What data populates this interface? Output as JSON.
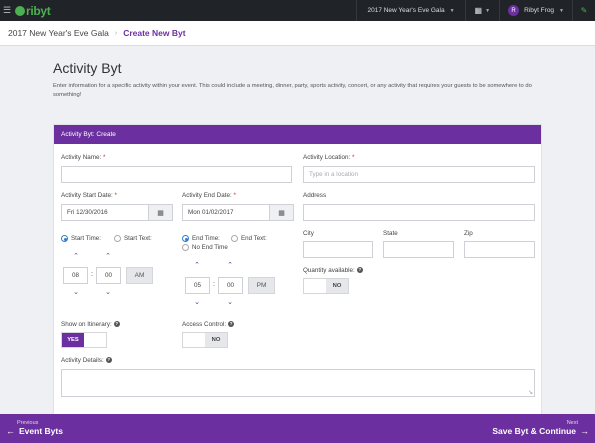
{
  "topbar": {
    "logo_text": "ribyt",
    "event_name": "2017 New Year's Eve Gala",
    "user_initial": "R",
    "user_name": "Ribyt Frog",
    "brand_color": "#6b2fa0",
    "accent_color": "#4caf50"
  },
  "breadcrumb": {
    "parent": "2017 New Year's Eve Gala",
    "current": "Create New Byt"
  },
  "page": {
    "title": "Activity Byt",
    "intro": "Enter information for a specific activity within your event. This could include a meeting, dinner, party, sports activity, concert, or any activity that requires your guests to be somewhere to do something!"
  },
  "panel": {
    "header": "Activity Byt: Create"
  },
  "form": {
    "activity_name_label": "Activity Name:",
    "activity_name_value": "",
    "activity_location_label": "Activity Location:",
    "activity_location_placeholder": "Type in a location",
    "start_date_label": "Activity Start Date:",
    "start_date_value": "Fri 12/30/2016",
    "end_date_label": "Activity End Date:",
    "end_date_value": "Mon 01/02/2017",
    "address_label": "Address",
    "start_time_option": "Start Time:",
    "start_text_option": "Start Text:",
    "end_time_option": "End Time:",
    "end_text_option": "End Text:",
    "no_end_time_option": "No End Time",
    "start_hour": "08",
    "start_minute": "00",
    "start_ampm": "AM",
    "end_hour": "05",
    "end_minute": "00",
    "end_ampm": "PM",
    "city_label": "City",
    "state_label": "State",
    "zip_label": "Zip",
    "quantity_label": "Quantity available:",
    "quantity_toggle": "NO",
    "itinerary_label": "Show on Itinerary:",
    "itinerary_toggle": "YES",
    "access_label": "Access Control:",
    "access_toggle": "NO",
    "details_label": "Activity Details:",
    "required_mark": "*",
    "help_mark": "?"
  },
  "nav": {
    "prev_small": "Previous",
    "prev_label": "Event Byts",
    "next_small": "Next",
    "next_label": "Save Byt & Continue"
  },
  "icons": [
    "menu-icon",
    "logo-icon",
    "grid-icon",
    "chevron-down-icon",
    "link-icon",
    "calendar-icon",
    "chevron-up-icon",
    "help-icon",
    "arrow-left-icon",
    "arrow-right-icon"
  ]
}
